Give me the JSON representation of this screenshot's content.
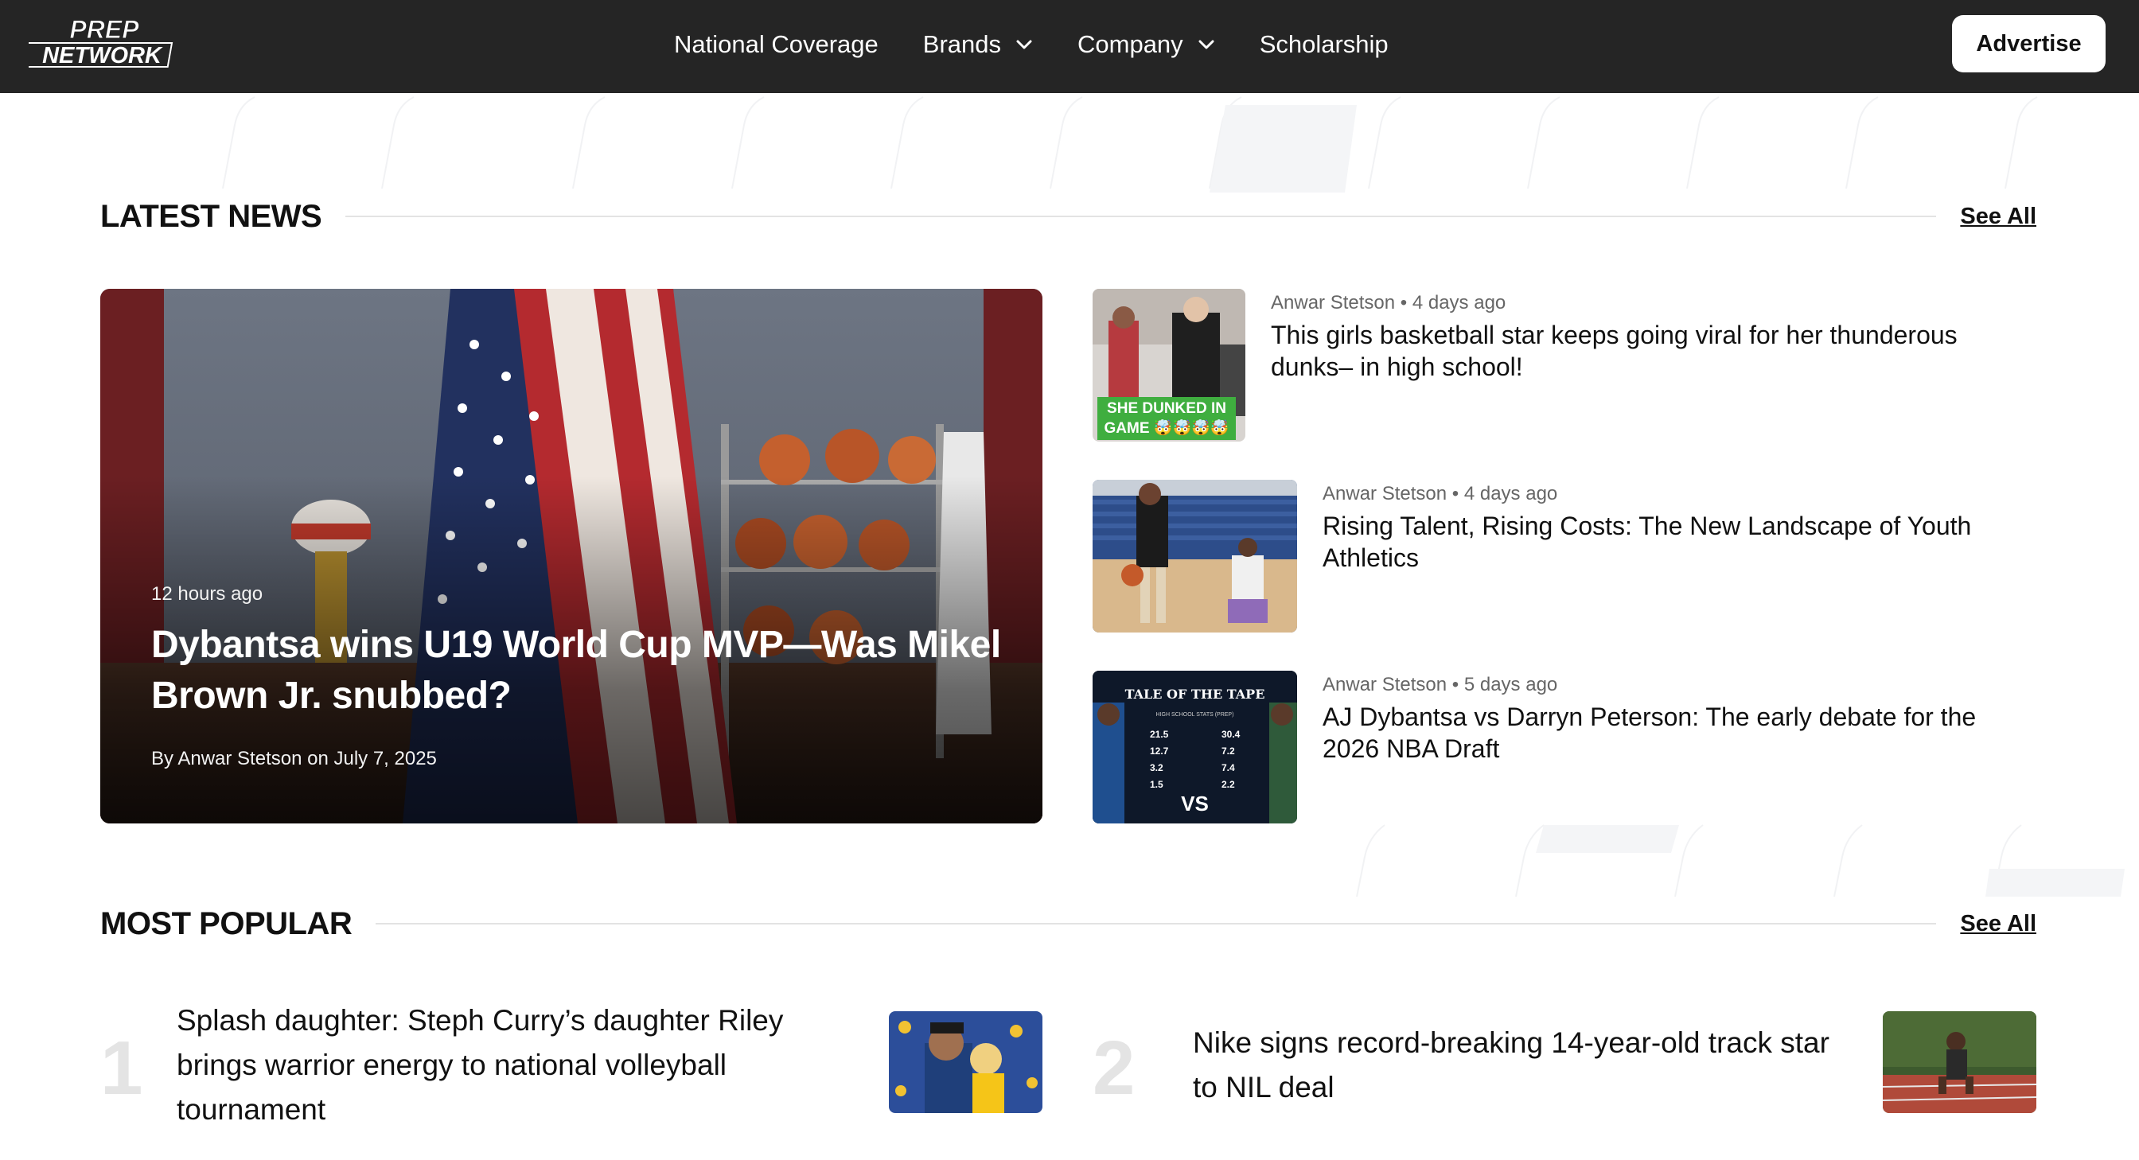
{
  "header": {
    "logo_line1": "PREP",
    "logo_line2": "NETWORK",
    "nav": [
      {
        "label": "National Coverage",
        "has_dropdown": false
      },
      {
        "label": "Brands",
        "has_dropdown": true
      },
      {
        "label": "Company",
        "has_dropdown": true
      },
      {
        "label": "Scholarship",
        "has_dropdown": false
      }
    ],
    "advertise_label": "Advertise",
    "dropdown_icon": "chevron-down-icon"
  },
  "latest_news": {
    "title": "LATEST NEWS",
    "see_all_label": "See All",
    "featured": {
      "time": "12 hours ago",
      "title": "Dybantsa wins U19 World Cup MVP—Was Mikel Brown Jr. snubbed?",
      "byline": "By Anwar Stetson on July 7, 2025"
    },
    "items": [
      {
        "author": "Anwar Stetson",
        "time": "4 days ago",
        "title": "This girls basketball star keeps going viral for her thunderous dunks– in high school!",
        "thumb_caption": "SHE DUNKED IN GAME 🤯🤯🤯🤯"
      },
      {
        "author": "Anwar Stetson",
        "time": "4 days ago",
        "title": "Rising Talent, Rising Costs: The New Landscape of Youth Athletics"
      },
      {
        "author": "Anwar Stetson",
        "time": "5 days ago",
        "title": "AJ Dybantsa vs Darryn Peterson: The early debate for the 2026 NBA Draft",
        "thumb_text": {
          "heading": "TALE OF THE TAPE",
          "subheading": "HIGH SCHOOL STATS (PREP)",
          "left_values": [
            "21.5",
            "12.7",
            "3.2",
            "1.5"
          ],
          "right_values": [
            "30.4",
            "7.2",
            "7.4",
            "2.2"
          ],
          "vs": "VS"
        }
      }
    ]
  },
  "most_popular": {
    "title": "MOST POPULAR",
    "see_all_label": "See All",
    "items": [
      {
        "rank": "1",
        "title": "Splash daughter: Steph Curry’s daughter Riley brings warrior energy to national volleyball tournament"
      },
      {
        "rank": "2",
        "title": "Nike signs record-breaking 14-year-old track star to NIL deal"
      }
    ]
  },
  "colors": {
    "nav_bg": "#252525",
    "text": "#111111",
    "muted": "#666666",
    "rank": "#e4e4e4",
    "rule": "#e3e3e3",
    "caption_green": "#3fae3f"
  }
}
